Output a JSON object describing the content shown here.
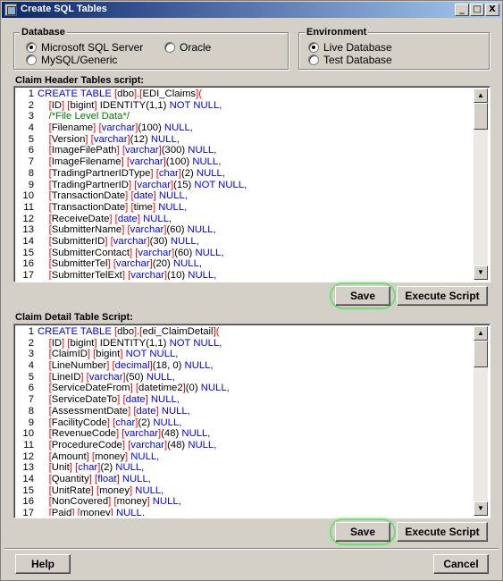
{
  "window": {
    "title": "Create SQL Tables"
  },
  "titlebar_buttons": {
    "minimize": "_",
    "maximize": "□",
    "close": "X"
  },
  "database": {
    "title": "Database",
    "options": [
      {
        "label": "Microsoft SQL Server",
        "selected": true
      },
      {
        "label": "Oracle",
        "selected": false
      },
      {
        "label": "MySQL/Generic",
        "selected": false
      }
    ]
  },
  "environment": {
    "title": "Environment",
    "options": [
      {
        "label": "Live Database",
        "selected": true
      },
      {
        "label": "Test Database",
        "selected": false
      }
    ]
  },
  "header_script": {
    "label": "Claim Header Tables script:",
    "lines": [
      [
        [
          "kw",
          "CREATE TABLE "
        ],
        [
          "br",
          "["
        ],
        [
          "tx",
          "dbo"
        ],
        [
          "br",
          "]"
        ],
        [
          "tx",
          "."
        ],
        [
          "br",
          "["
        ],
        [
          "tx",
          "EDI_Claims"
        ],
        [
          "br",
          "]("
        ]
      ],
      [
        [
          "tx",
          "\t"
        ],
        [
          "br",
          "["
        ],
        [
          "tx",
          "ID"
        ],
        [
          "br",
          "] "
        ],
        [
          "br",
          "["
        ],
        [
          "tx",
          "bigint"
        ],
        [
          "br",
          "] "
        ],
        [
          "tx",
          "IDENTITY(1,1) "
        ],
        [
          "kw",
          "NOT NULL,"
        ]
      ],
      [
        [
          "tx",
          "\t"
        ],
        [
          "cm",
          "/*File Level Data*/"
        ]
      ],
      [
        [
          "tx",
          "\t"
        ],
        [
          "br",
          "["
        ],
        [
          "tx",
          "Filename"
        ],
        [
          "br",
          "] "
        ],
        [
          "br",
          "["
        ],
        [
          "kw",
          "varchar"
        ],
        [
          "br",
          "]"
        ],
        [
          "tx",
          "(100) "
        ],
        [
          "kw",
          "NULL,"
        ]
      ],
      [
        [
          "tx",
          "\t"
        ],
        [
          "br",
          "["
        ],
        [
          "tx",
          "Version"
        ],
        [
          "br",
          "] "
        ],
        [
          "br",
          "["
        ],
        [
          "kw",
          "varchar"
        ],
        [
          "br",
          "]"
        ],
        [
          "tx",
          "(12) "
        ],
        [
          "kw",
          "NULL,"
        ]
      ],
      [
        [
          "tx",
          "\t"
        ],
        [
          "br",
          "["
        ],
        [
          "tx",
          "ImageFilePath"
        ],
        [
          "br",
          "] "
        ],
        [
          "br",
          "["
        ],
        [
          "kw",
          "varchar"
        ],
        [
          "br",
          "]"
        ],
        [
          "tx",
          "(300) "
        ],
        [
          "kw",
          "NULL,"
        ]
      ],
      [
        [
          "tx",
          "\t"
        ],
        [
          "br",
          "["
        ],
        [
          "tx",
          "ImageFilename"
        ],
        [
          "br",
          "] "
        ],
        [
          "br",
          "["
        ],
        [
          "kw",
          "varchar"
        ],
        [
          "br",
          "]"
        ],
        [
          "tx",
          "(100) "
        ],
        [
          "kw",
          "NULL,"
        ]
      ],
      [
        [
          "tx",
          "\t"
        ],
        [
          "br",
          "["
        ],
        [
          "tx",
          "TradingPartnerIDType"
        ],
        [
          "br",
          "] "
        ],
        [
          "br",
          "["
        ],
        [
          "kw",
          "char"
        ],
        [
          "br",
          "]"
        ],
        [
          "tx",
          "(2) "
        ],
        [
          "kw",
          "NULL,"
        ]
      ],
      [
        [
          "tx",
          "\t"
        ],
        [
          "br",
          "["
        ],
        [
          "tx",
          "TradingPartnerID"
        ],
        [
          "br",
          "] "
        ],
        [
          "br",
          "["
        ],
        [
          "kw",
          "varchar"
        ],
        [
          "br",
          "]"
        ],
        [
          "tx",
          "(15) "
        ],
        [
          "kw",
          "NOT NULL,"
        ]
      ],
      [
        [
          "tx",
          "\t"
        ],
        [
          "br",
          "["
        ],
        [
          "tx",
          "TransactionDate"
        ],
        [
          "br",
          "] "
        ],
        [
          "br",
          "["
        ],
        [
          "kw",
          "date"
        ],
        [
          "br",
          "] "
        ],
        [
          "kw",
          "NULL,"
        ]
      ],
      [
        [
          "tx",
          "\t"
        ],
        [
          "br",
          "["
        ],
        [
          "tx",
          "TransactionDate"
        ],
        [
          "br",
          "] "
        ],
        [
          "br",
          "["
        ],
        [
          "tx",
          "time"
        ],
        [
          "br",
          "] "
        ],
        [
          "kw",
          "NULL,"
        ]
      ],
      [
        [
          "tx",
          "\t"
        ],
        [
          "br",
          "["
        ],
        [
          "tx",
          "ReceiveDate"
        ],
        [
          "br",
          "] "
        ],
        [
          "br",
          "["
        ],
        [
          "kw",
          "date"
        ],
        [
          "br",
          "] "
        ],
        [
          "kw",
          "NULL,"
        ]
      ],
      [
        [
          "tx",
          "\t"
        ],
        [
          "br",
          "["
        ],
        [
          "tx",
          "SubmitterName"
        ],
        [
          "br",
          "] "
        ],
        [
          "br",
          "["
        ],
        [
          "kw",
          "varchar"
        ],
        [
          "br",
          "]"
        ],
        [
          "tx",
          "(60) "
        ],
        [
          "kw",
          "NULL,"
        ]
      ],
      [
        [
          "tx",
          "\t"
        ],
        [
          "br",
          "["
        ],
        [
          "tx",
          "SubmitterID"
        ],
        [
          "br",
          "] "
        ],
        [
          "br",
          "["
        ],
        [
          "kw",
          "varchar"
        ],
        [
          "br",
          "]"
        ],
        [
          "tx",
          "(30) "
        ],
        [
          "kw",
          "NULL,"
        ]
      ],
      [
        [
          "tx",
          "\t"
        ],
        [
          "br",
          "["
        ],
        [
          "tx",
          "SubmitterContact"
        ],
        [
          "br",
          "] "
        ],
        [
          "br",
          "["
        ],
        [
          "kw",
          "varchar"
        ],
        [
          "br",
          "]"
        ],
        [
          "tx",
          "(60) "
        ],
        [
          "kw",
          "NULL,"
        ]
      ],
      [
        [
          "tx",
          "\t"
        ],
        [
          "br",
          "["
        ],
        [
          "tx",
          "SubmitterTel"
        ],
        [
          "br",
          "] "
        ],
        [
          "br",
          "["
        ],
        [
          "kw",
          "varchar"
        ],
        [
          "br",
          "]"
        ],
        [
          "tx",
          "(20) "
        ],
        [
          "kw",
          "NULL,"
        ]
      ],
      [
        [
          "tx",
          "\t"
        ],
        [
          "br",
          "["
        ],
        [
          "tx",
          "SubmitterTelExt"
        ],
        [
          "br",
          "] "
        ],
        [
          "br",
          "["
        ],
        [
          "kw",
          "varchar"
        ],
        [
          "br",
          "]"
        ],
        [
          "tx",
          "(10) "
        ],
        [
          "kw",
          "NULL,"
        ]
      ]
    ],
    "save_label": "Save",
    "execute_label": "Execute Script"
  },
  "detail_script": {
    "label": "Claim Detail Table Script:",
    "lines": [
      [
        [
          "kw",
          "CREATE TABLE "
        ],
        [
          "br",
          "["
        ],
        [
          "tx",
          "dbo"
        ],
        [
          "br",
          "]"
        ],
        [
          "tx",
          "."
        ],
        [
          "br",
          "["
        ],
        [
          "tx",
          "edi_ClaimDetail"
        ],
        [
          "br",
          "]("
        ]
      ],
      [
        [
          "tx",
          "\t"
        ],
        [
          "br",
          "["
        ],
        [
          "tx",
          "ID"
        ],
        [
          "br",
          "] "
        ],
        [
          "br",
          "["
        ],
        [
          "tx",
          "bigint"
        ],
        [
          "br",
          "] "
        ],
        [
          "tx",
          "IDENTITY(1,1) "
        ],
        [
          "kw",
          "NOT NULL,"
        ]
      ],
      [
        [
          "tx",
          "\t"
        ],
        [
          "br",
          "["
        ],
        [
          "tx",
          "ClaimID"
        ],
        [
          "br",
          "] "
        ],
        [
          "br",
          "["
        ],
        [
          "tx",
          "bigint"
        ],
        [
          "br",
          "] "
        ],
        [
          "kw",
          "NOT NULL,"
        ]
      ],
      [
        [
          "tx",
          "\t"
        ],
        [
          "br",
          "["
        ],
        [
          "tx",
          "LineNumber"
        ],
        [
          "br",
          "] "
        ],
        [
          "br",
          "["
        ],
        [
          "kw",
          "decimal"
        ],
        [
          "br",
          "]"
        ],
        [
          "tx",
          "(18, 0) "
        ],
        [
          "kw",
          "NULL,"
        ]
      ],
      [
        [
          "tx",
          "\t"
        ],
        [
          "br",
          "["
        ],
        [
          "tx",
          "LineID"
        ],
        [
          "br",
          "] "
        ],
        [
          "br",
          "["
        ],
        [
          "kw",
          "varchar"
        ],
        [
          "br",
          "]"
        ],
        [
          "tx",
          "(50) "
        ],
        [
          "kw",
          "NULL,"
        ]
      ],
      [
        [
          "tx",
          "\t"
        ],
        [
          "br",
          "["
        ],
        [
          "tx",
          "ServiceDateFrom"
        ],
        [
          "br",
          "] "
        ],
        [
          "br",
          "["
        ],
        [
          "tx",
          "datetime2"
        ],
        [
          "br",
          "]"
        ],
        [
          "tx",
          "(0) "
        ],
        [
          "kw",
          "NULL,"
        ]
      ],
      [
        [
          "tx",
          "\t"
        ],
        [
          "br",
          "["
        ],
        [
          "tx",
          "ServiceDateTo"
        ],
        [
          "br",
          "] "
        ],
        [
          "br",
          "["
        ],
        [
          "kw",
          "date"
        ],
        [
          "br",
          "] "
        ],
        [
          "kw",
          "NULL,"
        ]
      ],
      [
        [
          "tx",
          "\t"
        ],
        [
          "br",
          "["
        ],
        [
          "tx",
          "AssessmentDate"
        ],
        [
          "br",
          "] "
        ],
        [
          "br",
          "["
        ],
        [
          "kw",
          "date"
        ],
        [
          "br",
          "] "
        ],
        [
          "kw",
          "NULL,"
        ]
      ],
      [
        [
          "tx",
          "\t"
        ],
        [
          "br",
          "["
        ],
        [
          "tx",
          "FacilityCode"
        ],
        [
          "br",
          "] "
        ],
        [
          "br",
          "["
        ],
        [
          "kw",
          "char"
        ],
        [
          "br",
          "]"
        ],
        [
          "tx",
          "(2) "
        ],
        [
          "kw",
          "NULL,"
        ]
      ],
      [
        [
          "tx",
          "\t"
        ],
        [
          "br",
          "["
        ],
        [
          "tx",
          "RevenueCode"
        ],
        [
          "br",
          "] "
        ],
        [
          "br",
          "["
        ],
        [
          "kw",
          "varchar"
        ],
        [
          "br",
          "]"
        ],
        [
          "tx",
          "(48) "
        ],
        [
          "kw",
          "NULL,"
        ]
      ],
      [
        [
          "tx",
          "\t"
        ],
        [
          "br",
          "["
        ],
        [
          "tx",
          "ProcedureCode"
        ],
        [
          "br",
          "] "
        ],
        [
          "br",
          "["
        ],
        [
          "kw",
          "varchar"
        ],
        [
          "br",
          "]"
        ],
        [
          "tx",
          "(48) "
        ],
        [
          "kw",
          "NULL,"
        ]
      ],
      [
        [
          "tx",
          "\t"
        ],
        [
          "br",
          "["
        ],
        [
          "tx",
          "Amount"
        ],
        [
          "br",
          "] "
        ],
        [
          "br",
          "["
        ],
        [
          "tx",
          "money"
        ],
        [
          "br",
          "] "
        ],
        [
          "kw",
          "NULL,"
        ]
      ],
      [
        [
          "tx",
          "\t"
        ],
        [
          "br",
          "["
        ],
        [
          "tx",
          "Unit"
        ],
        [
          "br",
          "] "
        ],
        [
          "br",
          "["
        ],
        [
          "kw",
          "char"
        ],
        [
          "br",
          "]"
        ],
        [
          "tx",
          "(2) "
        ],
        [
          "kw",
          "NULL,"
        ]
      ],
      [
        [
          "tx",
          "\t"
        ],
        [
          "br",
          "["
        ],
        [
          "tx",
          "Quantity"
        ],
        [
          "br",
          "] "
        ],
        [
          "br",
          "["
        ],
        [
          "kw",
          "float"
        ],
        [
          "br",
          "] "
        ],
        [
          "kw",
          "NULL,"
        ]
      ],
      [
        [
          "tx",
          "\t"
        ],
        [
          "br",
          "["
        ],
        [
          "tx",
          "UnitRate"
        ],
        [
          "br",
          "] "
        ],
        [
          "br",
          "["
        ],
        [
          "tx",
          "money"
        ],
        [
          "br",
          "] "
        ],
        [
          "kw",
          "NULL,"
        ]
      ],
      [
        [
          "tx",
          "\t"
        ],
        [
          "br",
          "["
        ],
        [
          "tx",
          "NonCovered"
        ],
        [
          "br",
          "] "
        ],
        [
          "br",
          "["
        ],
        [
          "tx",
          "money"
        ],
        [
          "br",
          "] "
        ],
        [
          "kw",
          "NULL,"
        ]
      ],
      [
        [
          "tx",
          "\t"
        ],
        [
          "br",
          "["
        ],
        [
          "tx",
          "Paid"
        ],
        [
          "br",
          "] "
        ],
        [
          "br",
          "["
        ],
        [
          "tx",
          "money"
        ],
        [
          "br",
          "] "
        ],
        [
          "kw",
          "NULL,"
        ]
      ]
    ],
    "save_label": "Save",
    "execute_label": "Execute Script"
  },
  "footer": {
    "help_label": "Help",
    "cancel_label": "Cancel"
  },
  "icons": {
    "scroll_up": "▲",
    "scroll_down": "▼"
  },
  "colors": {
    "keyword": "#0000ff",
    "bracket": "#ff0000",
    "comment": "#008000",
    "highlight": "#7ed67e",
    "title_start": "#0a246a"
  }
}
